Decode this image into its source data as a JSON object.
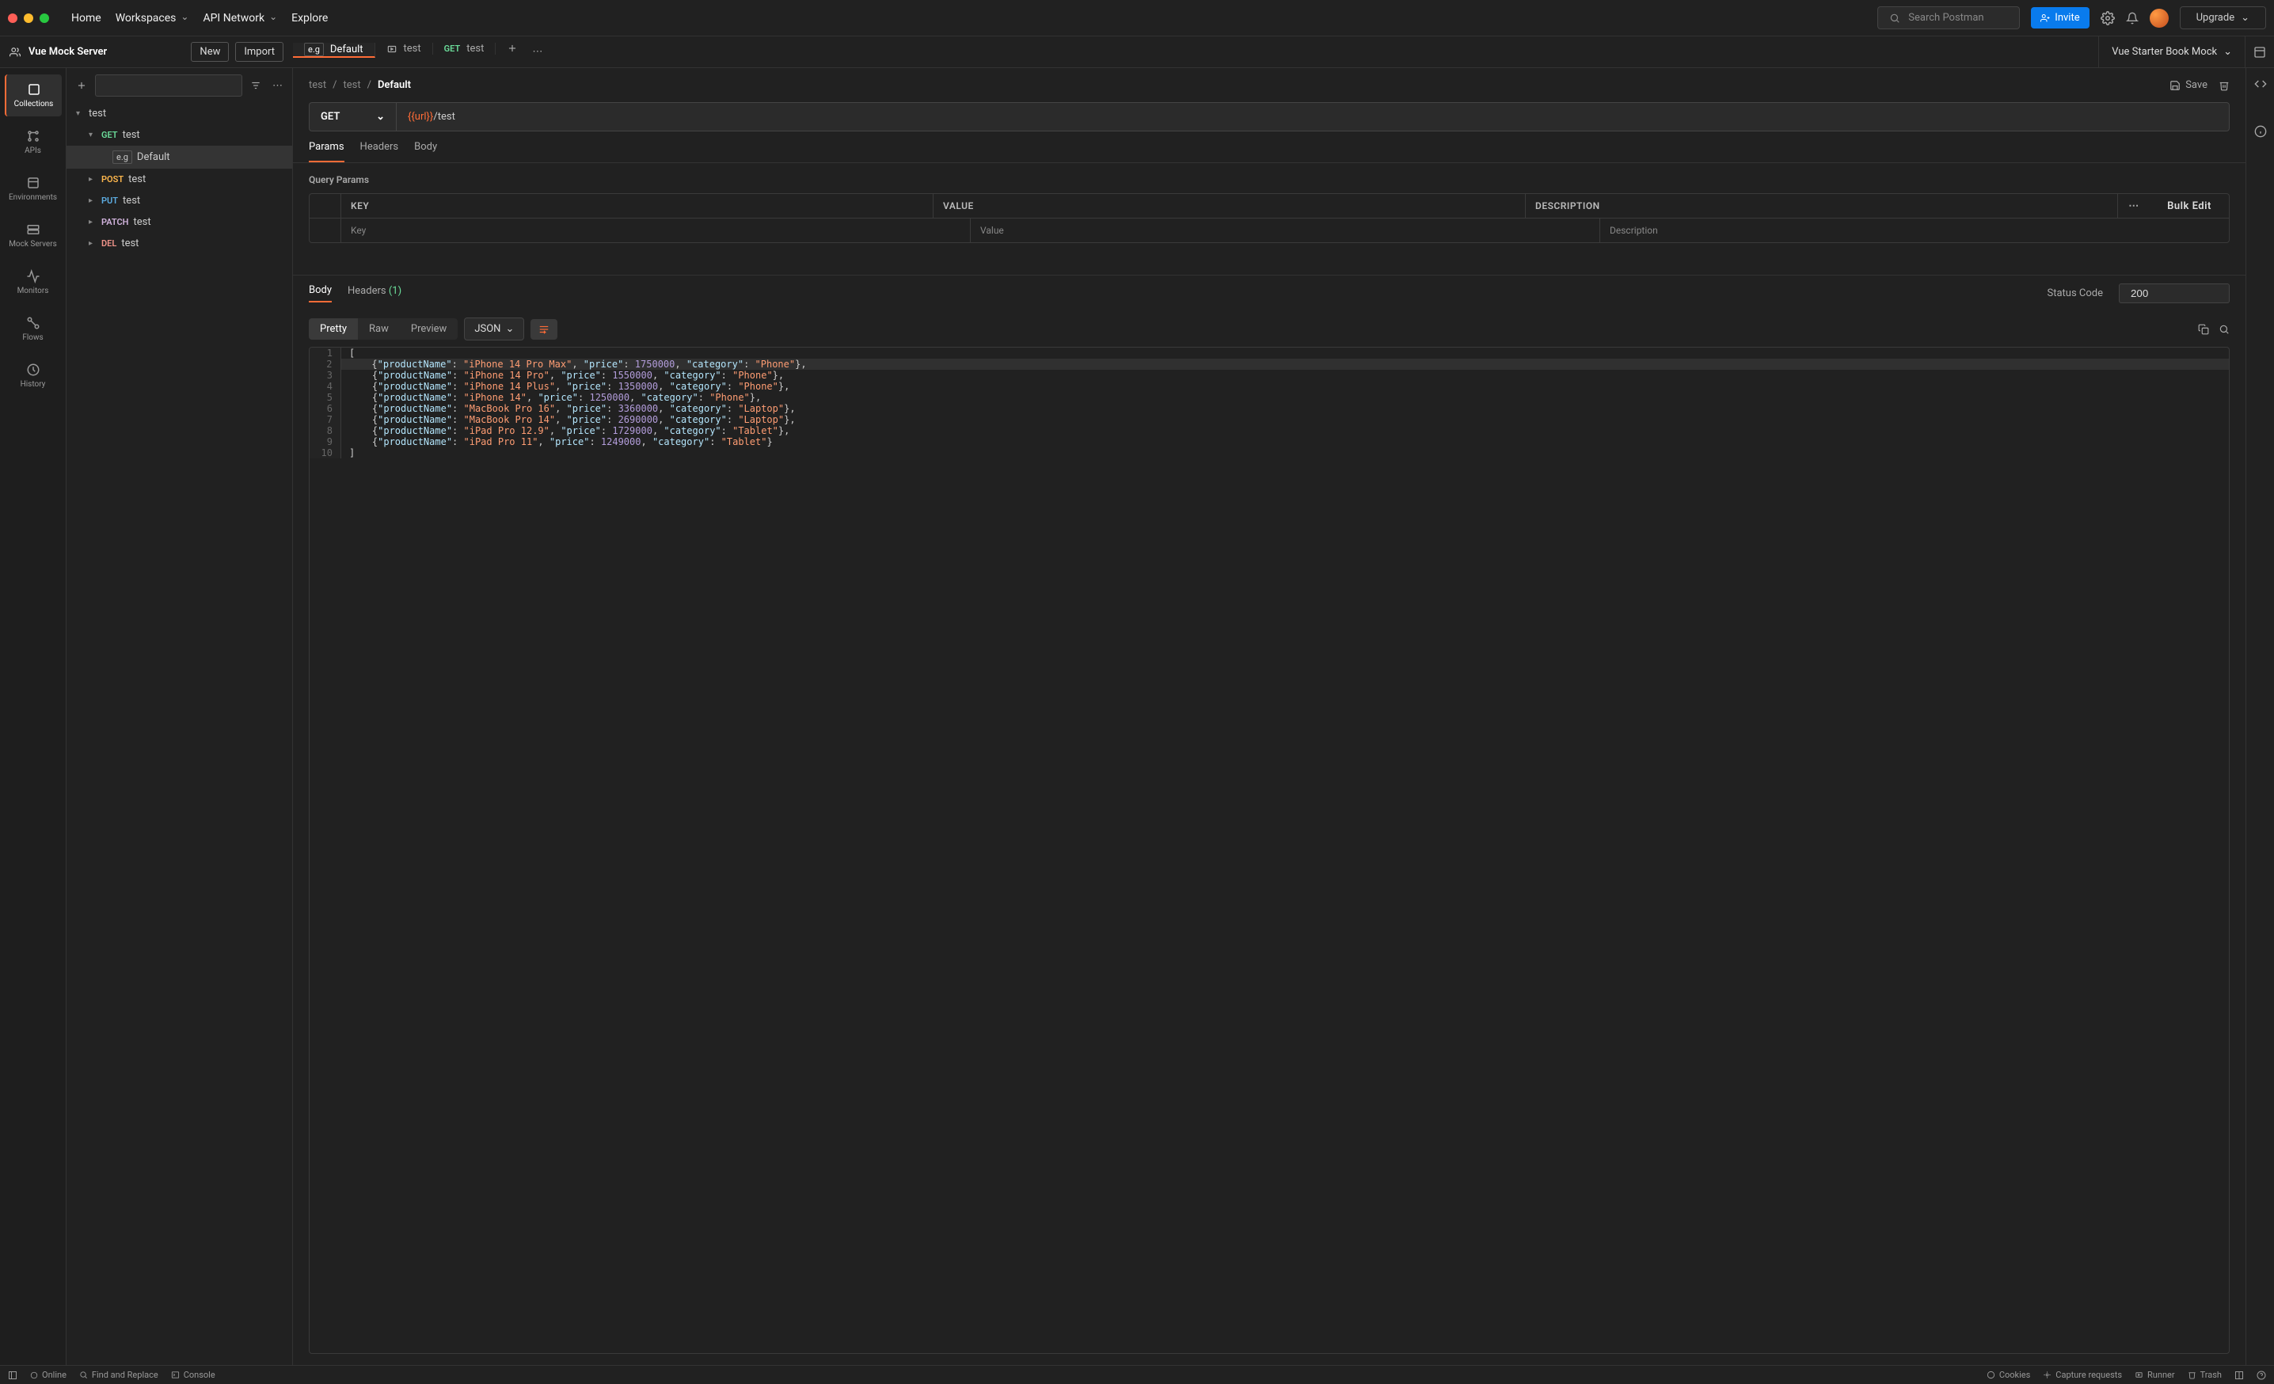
{
  "topbar": {
    "home": "Home",
    "workspaces": "Workspaces",
    "api_network": "API Network",
    "explore": "Explore",
    "search_placeholder": "Search Postman",
    "invite": "Invite",
    "upgrade": "Upgrade"
  },
  "workspace": {
    "name": "Vue Mock Server",
    "new_btn": "New",
    "import_btn": "Import",
    "environment": "Vue Starter Book Mock"
  },
  "tabs": [
    {
      "icon": "example",
      "label": "Default",
      "active": true
    },
    {
      "icon": "folder",
      "label": "test",
      "active": false
    },
    {
      "method": "GET",
      "label": "test",
      "active": false
    }
  ],
  "rail": {
    "collections": "Collections",
    "apis": "APIs",
    "environments": "Environments",
    "mock_servers": "Mock Servers",
    "monitors": "Monitors",
    "flows": "Flows",
    "history": "History"
  },
  "tree": {
    "root": "test",
    "items": [
      {
        "method": "GET",
        "label": "test",
        "expanded": true
      },
      {
        "example": true,
        "label": "Default",
        "selected": true,
        "child": true
      },
      {
        "method": "POST",
        "label": "test"
      },
      {
        "method": "PUT",
        "label": "test"
      },
      {
        "method": "PATCH",
        "label": "test"
      },
      {
        "method": "DEL",
        "label": "test"
      }
    ]
  },
  "breadcrumb": {
    "parts": [
      "test",
      "test"
    ],
    "current": "Default",
    "save": "Save"
  },
  "request": {
    "method": "GET",
    "url_var": "{{url}}",
    "url_path": "/test",
    "tabs": {
      "params": "Params",
      "headers": "Headers",
      "body": "Body"
    },
    "section": "Query Params",
    "table": {
      "key_h": "KEY",
      "value_h": "VALUE",
      "desc_h": "DESCRIPTION",
      "key_ph": "Key",
      "value_ph": "Value",
      "desc_ph": "Description",
      "bulk_edit": "Bulk Edit"
    }
  },
  "response": {
    "tabs": {
      "body": "Body",
      "headers": "Headers",
      "headers_count": "(1)"
    },
    "status_label": "Status Code",
    "status_value": "200",
    "views": {
      "pretty": "Pretty",
      "raw": "Raw",
      "preview": "Preview"
    },
    "format": "JSON"
  },
  "code_lines": [
    "[",
    "    {\"productName\": \"iPhone 14 Pro Max\", \"price\": 1750000, \"category\": \"Phone\"},",
    "    {\"productName\": \"iPhone 14 Pro\", \"price\": 1550000, \"category\": \"Phone\"},",
    "    {\"productName\": \"iPhone 14 Plus\", \"price\": 1350000, \"category\": \"Phone\"},",
    "    {\"productName\": \"iPhone 14\", \"price\": 1250000, \"category\": \"Phone\"},",
    "    {\"productName\": \"MacBook Pro 16\", \"price\": 3360000, \"category\": \"Laptop\"},",
    "    {\"productName\": \"MacBook Pro 14\", \"price\": 2690000, \"category\": \"Laptop\"},",
    "    {\"productName\": \"iPad Pro 12.9\", \"price\": 1729000, \"category\": \"Tablet\"},",
    "    {\"productName\": \"iPad Pro 11\", \"price\": 1249000, \"category\": \"Tablet\"}",
    "]"
  ],
  "statusbar": {
    "online": "Online",
    "find_replace": "Find and Replace",
    "console": "Console",
    "cookies": "Cookies",
    "capture": "Capture requests",
    "runner": "Runner",
    "trash": "Trash"
  }
}
